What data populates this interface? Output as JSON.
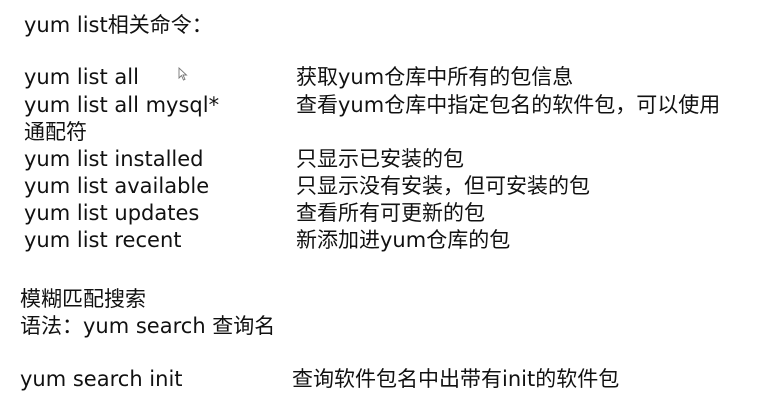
{
  "heading": "yum list相关命令：",
  "commands": [
    {
      "cmd": "yum list all",
      "desc": "获取yum仓库中所有的包信息"
    },
    {
      "cmd": "yum list all mysql*",
      "desc": "查看yum仓库中指定包名的软件包，可以使用",
      "desc_cont": "通配符"
    },
    {
      "cmd": "yum list installed",
      "desc": "只显示已安装的包"
    },
    {
      "cmd": "yum list available",
      "desc": "只显示没有安装，但可安装的包"
    },
    {
      "cmd": "yum list updates",
      "desc": "查看所有可更新的包"
    },
    {
      "cmd": "yum list recent",
      "desc": "新添加进yum仓库的包"
    }
  ],
  "search": {
    "title": "模糊匹配搜索",
    "syntax": "语法：yum search 查询名",
    "example_cmd": "yum search init",
    "example_desc": "查询软件包名中出带有init的软件包"
  },
  "icons": {
    "cursor": "mouse-pointer-icon"
  }
}
